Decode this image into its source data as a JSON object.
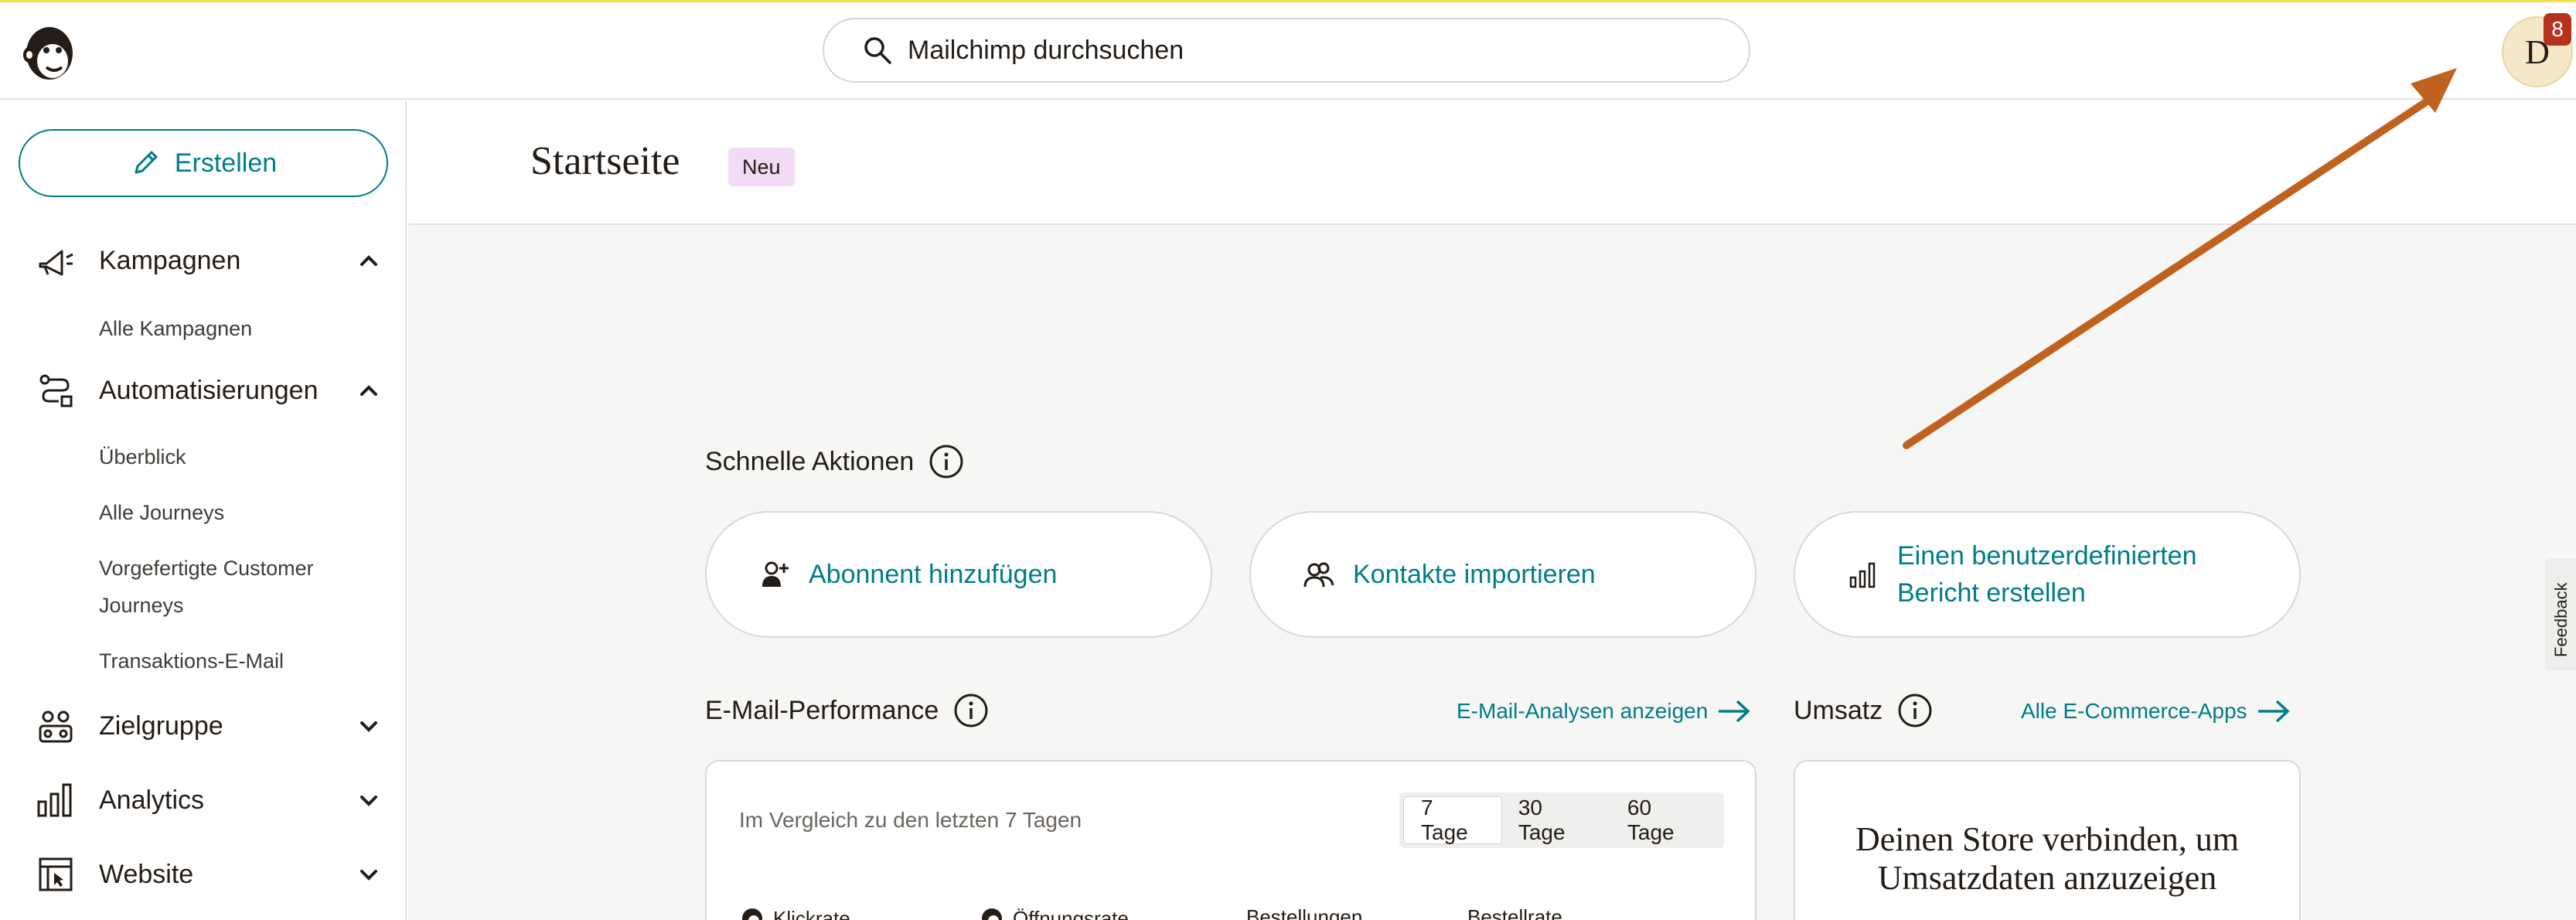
{
  "header": {
    "search_placeholder": "Mailchimp durchsuchen",
    "avatar_initial": "D",
    "notification_count": "8"
  },
  "sidebar": {
    "create_label": "Erstellen",
    "groups": [
      {
        "label": "Kampagnen",
        "icon": "megaphone-icon",
        "expanded": true,
        "items": [
          "Alle Kampagnen"
        ]
      },
      {
        "label": "Automatisierungen",
        "icon": "automation-icon",
        "expanded": true,
        "items": [
          "Überblick",
          "Alle Journeys",
          "Vorgefertigte Customer",
          "Journeys",
          "Transaktions-E-Mail"
        ]
      },
      {
        "label": "Zielgruppe",
        "icon": "audience-icon",
        "expanded": false
      },
      {
        "label": "Analytics",
        "icon": "bar-chart-icon",
        "expanded": false
      },
      {
        "label": "Website",
        "icon": "website-icon",
        "expanded": false
      }
    ]
  },
  "page": {
    "title": "Startseite",
    "badge": "Neu"
  },
  "quick_actions": {
    "title": "Schnelle Aktionen",
    "cards": [
      {
        "label": "Abonnent hinzufügen",
        "icon": "add-person-icon"
      },
      {
        "label": "Kontakte importieren",
        "icon": "contacts-icon"
      },
      {
        "label_line1": "Einen benutzerdefinierten",
        "label_line2": "Bericht erstellen",
        "icon": "bar-chart-icon"
      }
    ]
  },
  "email_performance": {
    "title": "E-Mail-Performance",
    "link": "E-Mail-Analysen anzeigen",
    "compare_text": "Im Vergleich zu den letzten 7 Tagen",
    "ranges": [
      "7 Tage",
      "30 Tage",
      "60 Tage"
    ],
    "active_range": "7 Tage",
    "metrics": [
      "Klickrate",
      "Öffnungsrate",
      "Bestellungen",
      "Bestellrate"
    ]
  },
  "revenue": {
    "title": "Umsatz",
    "link": "Alle E-Commerce-Apps",
    "heading_line1": "Deinen Store verbinden, um",
    "heading_line2": "Umsatzdaten anzuzeigen"
  },
  "feedback_label": "Feedback",
  "colors": {
    "accent": "#007c89",
    "annotation_arrow": "#c0621f",
    "badge_bg": "#f2dcf5",
    "notification_badge": "#b5331e"
  }
}
